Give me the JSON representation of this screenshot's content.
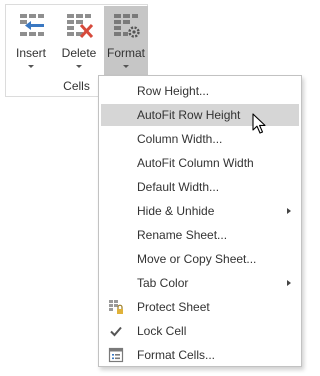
{
  "ribbon": {
    "buttons": {
      "insert": "Insert",
      "delete": "Delete",
      "format": "Format"
    },
    "group_label": "Cells"
  },
  "menu": {
    "items": [
      {
        "label": "Row Height..."
      },
      {
        "label": "AutoFit Row Height",
        "highlighted": true
      },
      {
        "label": "Column Width..."
      },
      {
        "label": "AutoFit Column Width"
      },
      {
        "label": "Default Width..."
      },
      {
        "label": "Hide & Unhide",
        "submenu": true
      },
      {
        "label": "Rename Sheet..."
      },
      {
        "label": "Move or Copy Sheet..."
      },
      {
        "label": "Tab Color",
        "submenu": true
      },
      {
        "label": "Protect Sheet",
        "icon": "protect-sheet-icon"
      },
      {
        "label": "Lock Cell",
        "icon": "checkmark-icon"
      },
      {
        "label": "Format Cells...",
        "icon": "format-cells-icon"
      }
    ]
  },
  "colors": {
    "active_button_bg": "#c6c6c6",
    "highlight_bg": "#d6d6d6",
    "accent_red": "#d64a3b",
    "lock_yellow": "#e0b23a"
  }
}
